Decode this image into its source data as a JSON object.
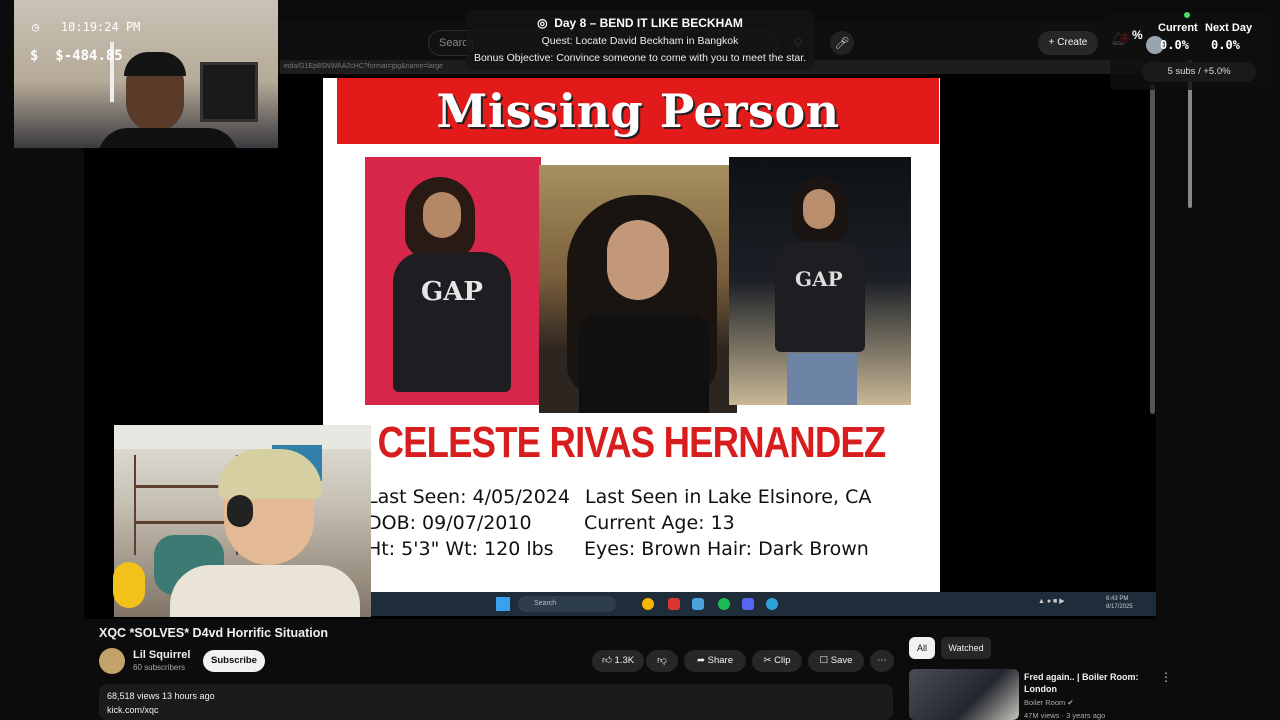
{
  "overlay": {
    "time": "10:19:24 PM",
    "money": "$-484.85",
    "money_symbol": "$",
    "money_value": "-484.85",
    "quest_title": "Day 8 – BEND IT LIKE BECKHAM",
    "quest_line": "Quest: Locate David Beckham in Bangkok",
    "bonus_line": "Bonus Objective: Convince someone to come with you to meet the star.",
    "stats": {
      "current_label": "Current",
      "current_value": "0.0%",
      "next_label": "Next Day",
      "next_value": "0.0%",
      "subs": "5 subs / +5.0%",
      "percent_icon": "%"
    }
  },
  "youtube_header": {
    "search_placeholder": "Search",
    "create_label": "Create",
    "notification_count": "1"
  },
  "poster": {
    "title": "Missing Person",
    "name": "CELESTE RIVAS HERNANDEZ",
    "last_seen": "Last Seen:  4/05/2024",
    "last_seen_in": "Last Seen in Lake Elsinore, CA",
    "dob": "DOB: 09/07/2010",
    "current_age": "Current Age: 13",
    "height_weight": "Ht: 5'3\"  Wt: 120 lbs",
    "eyes_hair": "Eyes: Brown  Hair:  Dark Brown"
  },
  "taskbar": {
    "search_label": "Search"
  },
  "video": {
    "title": "XQC *SOLVES* D4vd Horrific Situation",
    "channel": "Lil Squirrel",
    "channel_subs": "60 subscribers",
    "subscribe_label": "Subscribe",
    "likes": "1.3K",
    "share_label": "Share",
    "clip_label": "Clip",
    "save_label": "Save",
    "views_line": "68,518 views  13 hours ago",
    "description_link": "kick.com/xqc"
  },
  "sidebar": {
    "chips": [
      "All",
      "Watched"
    ],
    "recommended": {
      "title": "Fred again.. | Boiler Room: London",
      "channel": "Boiler Room",
      "meta": "47M views · 3 years ago"
    }
  }
}
